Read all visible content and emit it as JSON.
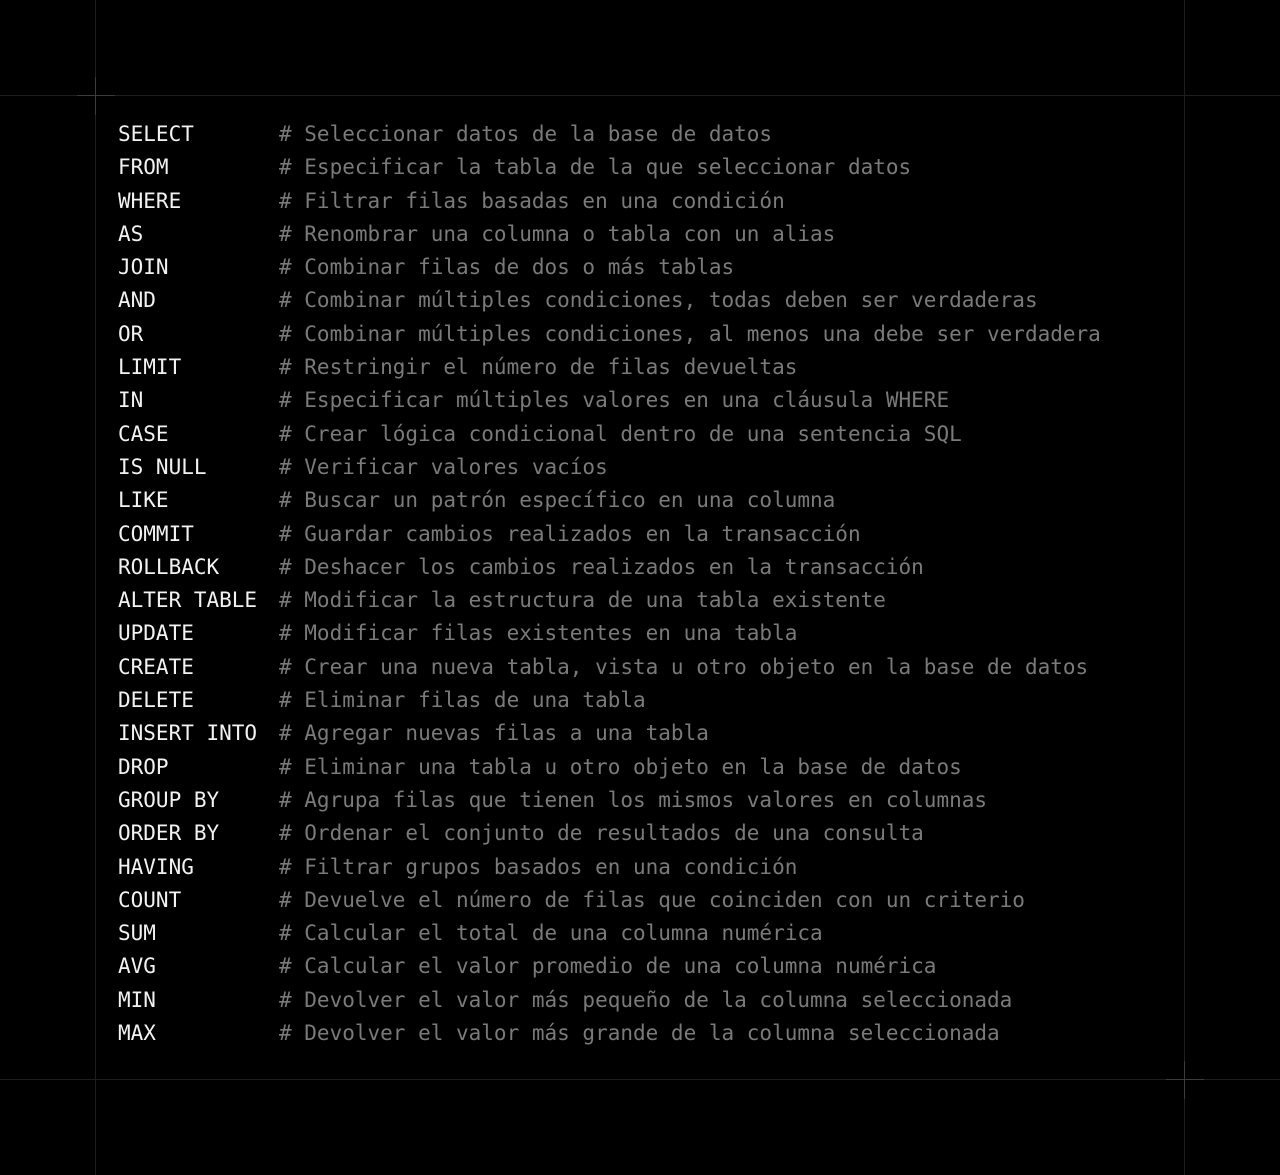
{
  "colors": {
    "background": "#000000",
    "keyword": "#f2f2f2",
    "comment": "#7a7a7a",
    "guide": "#1e1e1e"
  },
  "icons": [
    "plus-crosshair-icon"
  ],
  "commands": [
    {
      "keyword": "SELECT",
      "comment": "# Seleccionar datos de la base de datos"
    },
    {
      "keyword": "FROM",
      "comment": "# Especificar la tabla de la que seleccionar datos"
    },
    {
      "keyword": "WHERE",
      "comment": "# Filtrar filas basadas en una condición"
    },
    {
      "keyword": "AS",
      "comment": "# Renombrar una columna o tabla con un alias"
    },
    {
      "keyword": "JOIN",
      "comment": "# Combinar filas de dos o más tablas"
    },
    {
      "keyword": "AND",
      "comment": "# Combinar múltiples condiciones, todas deben ser verdaderas"
    },
    {
      "keyword": "OR",
      "comment": "# Combinar múltiples condiciones, al menos una debe ser verdadera"
    },
    {
      "keyword": "LIMIT",
      "comment": "# Restringir el número de filas devueltas"
    },
    {
      "keyword": "IN",
      "comment": "# Especificar múltiples valores en una cláusula WHERE"
    },
    {
      "keyword": "CASE",
      "comment": "# Crear lógica condicional dentro de una sentencia SQL"
    },
    {
      "keyword": "IS NULL",
      "comment": "# Verificar valores vacíos"
    },
    {
      "keyword": "LIKE",
      "comment": "# Buscar un patrón específico en una columna"
    },
    {
      "keyword": "COMMIT",
      "comment": "# Guardar cambios realizados en la transacción"
    },
    {
      "keyword": "ROLLBACK",
      "comment": "# Deshacer los cambios realizados en la transacción"
    },
    {
      "keyword": "ALTER TABLE",
      "comment": "# Modificar la estructura de una tabla existente"
    },
    {
      "keyword": "UPDATE",
      "comment": "# Modificar filas existentes en una tabla"
    },
    {
      "keyword": "CREATE",
      "comment": "# Crear una nueva tabla, vista u otro objeto en la base de datos"
    },
    {
      "keyword": "DELETE",
      "comment": "# Eliminar filas de una tabla"
    },
    {
      "keyword": "INSERT INTO",
      "comment": "# Agregar nuevas filas a una tabla"
    },
    {
      "keyword": "DROP",
      "comment": "# Eliminar una tabla u otro objeto en la base de datos"
    },
    {
      "keyword": "GROUP BY",
      "comment": "# Agrupa filas que tienen los mismos valores en columnas"
    },
    {
      "keyword": "ORDER BY",
      "comment": "# Ordenar el conjunto de resultados de una consulta"
    },
    {
      "keyword": "HAVING",
      "comment": "# Filtrar grupos basados en una condición"
    },
    {
      "keyword": "COUNT",
      "comment": "# Devuelve el número de filas que coinciden con un criterio"
    },
    {
      "keyword": "SUM",
      "comment": "# Calcular el total de una columna numérica"
    },
    {
      "keyword": "AVG",
      "comment": "# Calcular el valor promedio de una columna numérica"
    },
    {
      "keyword": "MIN",
      "comment": "# Devolver el valor más pequeño de la columna seleccionada"
    },
    {
      "keyword": "MAX",
      "comment": "# Devolver el valor más grande de la columna seleccionada"
    }
  ]
}
